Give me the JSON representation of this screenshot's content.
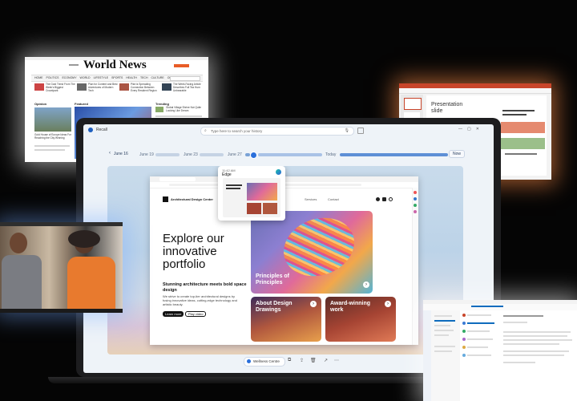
{
  "news": {
    "site_title": "World News",
    "nav": [
      "HOME",
      "POLITICS",
      "ECONOMY",
      "WORLD",
      "LIFESTYLE",
      "SPORTS",
      "HEALTH",
      "TECH",
      "CULTURE",
      "OPINIONS"
    ],
    "headlines": [
      "The Gold Trend From The Week's Biggest Crowdpark",
      "Plan for Content and Best Adventures of Modern Tech",
      "Pilot is Spreading Connection Between Every Resident Region",
      "The Week-Facing Article Describes Full Tea Hum Unbearable"
    ],
    "sections": [
      "Opinion",
      "Featured",
      "Trending"
    ],
    "opinion_story": "Gold House of Europe Ideas For Reaching the City Winning",
    "trending_story": "Global Village Shrine Not Quite Looking Like Dream"
  },
  "ppt": {
    "slide_title": "Presentation slide"
  },
  "recall": {
    "app_name": "Recall",
    "search_placeholder": "Type here to search your history",
    "timeline": {
      "start": "June 16",
      "labels": [
        "June 19",
        "June 23",
        "June 27",
        "Today"
      ],
      "now": "Now"
    },
    "hover_card": {
      "time": "11:42 AM",
      "app": "Edge"
    },
    "dock": {
      "app_label": "Wellness Centre"
    }
  },
  "website": {
    "brand": "Architectural Design Center",
    "nav": [
      "Projects",
      "Services",
      "Contact"
    ],
    "heading": "Explore our innovative portfolio",
    "subheading": "Stunning architecture meets bold space design",
    "body": "We strive to create top-tier architectural designs by fusing innovative ideas, cutting-edge technology and artistic beauty.",
    "learn_more": "Learn more",
    "play_video": "Play video",
    "cards": [
      {
        "title": "Principles of Principles"
      },
      {
        "title": "About Design Drawings"
      },
      {
        "title": "Award-winning work"
      }
    ]
  },
  "colors": {
    "accent": "#3a7bd5",
    "timeline": "#c5d3e4",
    "ppt_orange": "#c8452a",
    "outlook_blue": "#0f6cbd"
  }
}
